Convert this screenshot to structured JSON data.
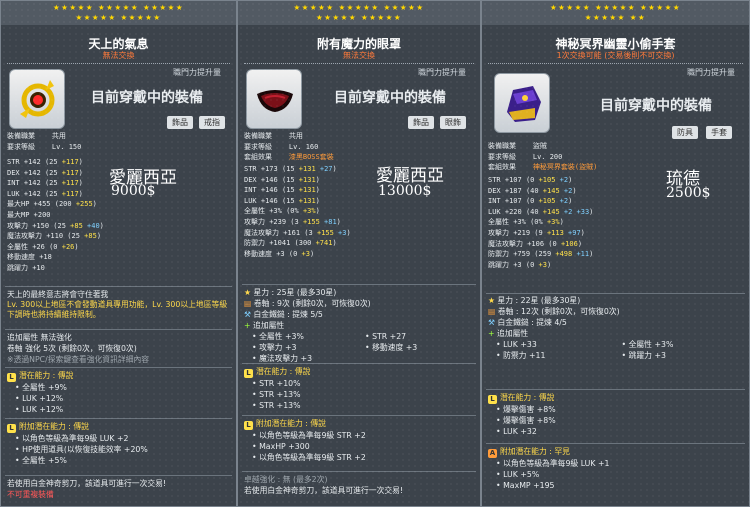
{
  "panels": [
    {
      "stars_row1": "★★★★★ ★★★★★ ★★★★★",
      "stars_row2": "★★★★★ ★★★★★",
      "title": "天上的氣息",
      "subtitle": "無法交換",
      "growth_label": "職門力提升量",
      "equipped_label": "目前穿戴中的裝備",
      "tags": [
        "飾品",
        "戒指"
      ],
      "job_label": "裝備職業",
      "job_value": "共用",
      "level_label": "要求等級",
      "level_value": "Lv. 150",
      "stats": [
        {
          "label": "STR",
          "base": "+142",
          "detail": "(25 ",
          "plus": "+117",
          "close": ")"
        },
        {
          "label": "DEX",
          "base": "+142",
          "detail": "(25 ",
          "plus": "+117",
          "close": ")"
        },
        {
          "label": "INT",
          "base": "+142",
          "detail": "(25 ",
          "plus": "+117",
          "close": ")"
        },
        {
          "label": "LUK",
          "base": "+142",
          "detail": "(25 ",
          "plus": "+117",
          "close": ")"
        },
        {
          "label": "最大HP",
          "base": "+455",
          "detail": "(200 ",
          "plus": "+255",
          "close": ")"
        },
        {
          "label": "最大MP",
          "base": "+200",
          "detail": "",
          "plus": "",
          "close": ""
        },
        {
          "label": "攻擊力",
          "base": "+150",
          "detail": "(25 ",
          "plus": "+85",
          "plus2": " +40",
          "close": ")"
        },
        {
          "label": "魔法攻擊力",
          "base": "+110",
          "detail": "(25 ",
          "plus": "+85",
          "close": ")"
        },
        {
          "label": "全屬性",
          "base": "+26",
          "detail": "(0 ",
          "plus": "+26",
          "close": ")"
        },
        {
          "label": "移動速度",
          "base": "+18",
          "detail": "",
          "plus": "",
          "close": ""
        },
        {
          "label": "跳躍力",
          "base": "+10",
          "detail": "",
          "plus": "",
          "close": ""
        }
      ],
      "handwritten_name": "愛麗西亞",
      "handwritten_price": "9000$",
      "desc_line1": "天上的最終意志將會守住著我",
      "desc_line2": "Lv. 300以上地區不會發動道具專用功能，Lv. 300以上地區等級下調時也將持續維持限制。",
      "extra_opt": "追加屬性 無法強化",
      "extra_opt2": "卷軸 強化 5次 (剩餘0次，可恢復0次)",
      "extra_note": "※透過NPC/探索鍵查看強化資訊詳細內容",
      "potential_header": "潛在能力 : 傳說",
      "potential_lines": [
        "全屬性 +9%",
        "LUK +12%",
        "LUK +12%"
      ],
      "addpot_header": "附加潛在能力 : 傳說",
      "addpot_lines": [
        "以角色等級為準每9級 LUK +2",
        "HP使用道具(以恢復技能效率 +20%",
        "全屬性 +5%"
      ],
      "footer1": "若使用白金神奇剪刀，該道具可進行一次交易!",
      "footer2": "不可重複裝備"
    },
    {
      "stars_row1": "★★★★★ ★★★★★ ★★★★★",
      "stars_row2": "★★★★★ ★★★★★",
      "title": "附有魔力的眼罩",
      "subtitle": "無法交換",
      "growth_label": "職門力提升量",
      "equipped_label": "目前穿戴中的裝備",
      "tags": [
        "飾品",
        "眼飾"
      ],
      "job_label": "裝備職業",
      "job_value": "共用",
      "level_label": "要求等級",
      "level_value": "Lv. 160",
      "set_label": "套組效果",
      "set_value": "漆黑BOSS套裝",
      "stats": [
        {
          "label": "STR",
          "base": "+173",
          "detail": "(15 ",
          "plus": "+131",
          "plus2": " +27",
          "close": ")"
        },
        {
          "label": "DEX",
          "base": "+146",
          "detail": "(15 ",
          "plus": "+131",
          "close": ")"
        },
        {
          "label": "INT",
          "base": "+146",
          "detail": "(15 ",
          "plus": "+131",
          "close": ")"
        },
        {
          "label": "LUK",
          "base": "+146",
          "detail": "(15 ",
          "plus": "+131",
          "close": ")"
        },
        {
          "label": "全屬性",
          "base": "+3%",
          "detail": "(0% ",
          "plus": "+3%",
          "close": ")"
        },
        {
          "label": "攻擊力",
          "base": "+239",
          "detail": "(3 ",
          "plus": "+155",
          "plus2": " +81",
          "close": ")"
        },
        {
          "label": "魔法攻擊力",
          "base": "+161",
          "detail": "(3 ",
          "plus": "+155",
          "plus2": " +3",
          "close": ")"
        },
        {
          "label": "防禦力",
          "base": "+1041",
          "detail": "(300 ",
          "plus": "+741",
          "close": ")"
        },
        {
          "label": "移動速度",
          "base": "+3",
          "detail": "(0 ",
          "plus": "+3",
          "close": ")"
        }
      ],
      "handwritten_name": "愛麗西亞",
      "handwritten_price": "13000$",
      "starforce": "星力 : 25星 (最多30星)",
      "scroll": "卷軸 : 9次 (剩餘0次，可恢復0次)",
      "hammer": "白金鐵鎚 : 提煉 5/5",
      "extra_header": "追加屬性",
      "extra_grid": [
        "全屬性 +3%",
        "STR +27",
        "攻擊力 +3",
        "移動速度 +3",
        "魔法攻擊力 +3",
        ""
      ],
      "potential_header": "潛在能力 : 傳說",
      "potential_lines": [
        "STR +10%",
        "STR +13%",
        "STR +13%"
      ],
      "addpot_header": "附加潛在能力 : 傳說",
      "addpot_lines": [
        "以角色等級為準每9級 STR +2",
        "MaxHP +300",
        "以角色等級為準每9級 STR +2"
      ],
      "soul_line": "卓越強化 : 無 (最多2次)",
      "footer1": "若使用白金神奇剪刀，該道具可進行一次交易!"
    },
    {
      "stars_row1": "★★★★★ ★★★★★ ★★★★★",
      "stars_row2": "★★★★★ ★★",
      "title": "神秘冥界幽靈小偷手套",
      "subtitle": "1次交換可能 (交易後則不可交換)",
      "growth_label": "職門力提升量",
      "equipped_label": "目前穿戴中的裝備",
      "tags": [
        "防具",
        "手套"
      ],
      "job_label": "裝備職業",
      "job_value": "盜賊",
      "level_label": "要求等級",
      "level_value": "Lv. 200",
      "set_label": "套組效果",
      "set_value": "神秘冥界套裝(盜賊)",
      "stats": [
        {
          "label": "STR",
          "base": "+107",
          "detail": "(0 ",
          "plus": "+105",
          "plus2": " +2",
          "close": ")"
        },
        {
          "label": "DEX",
          "base": "+187",
          "detail": "(40 ",
          "plus": "+145",
          "plus2": " +2",
          "close": ")"
        },
        {
          "label": "INT",
          "base": "+107",
          "detail": "(0 ",
          "plus": "+105",
          "plus2": " +2",
          "close": ")"
        },
        {
          "label": "LUK",
          "base": "+220",
          "detail": "(40 ",
          "plus": "+145",
          "plus2": " +2 +33",
          "close": ")"
        },
        {
          "label": "全屬性",
          "base": "+3%",
          "detail": "(0% ",
          "plus": "+3%",
          "close": ")"
        },
        {
          "label": "攻擊力",
          "base": "+219",
          "detail": "(9 ",
          "plus": "+113",
          "plus2": " +97",
          "close": ")"
        },
        {
          "label": "魔法攻擊力",
          "base": "+106",
          "detail": "(0 ",
          "plus": "+106",
          "close": ")"
        },
        {
          "label": "防禦力",
          "base": "+759",
          "detail": "(259 ",
          "plus": "+498",
          "plus2": " +11",
          "close": ")"
        },
        {
          "label": "跳躍力",
          "base": "+3",
          "detail": "(0 ",
          "plus": "+3",
          "close": ")"
        }
      ],
      "handwritten_name": "琉德",
      "handwritten_price": "2500$",
      "starforce": "星力 : 22星 (最多30星)",
      "scroll": "卷軸 : 12次 (剩餘0次，可恢復0次)",
      "hammer": "白金鐵鎚 : 提煉 4/5",
      "extra_header": "追加屬性",
      "extra_grid": [
        "LUK +33",
        "全屬性 +3%",
        "防禦力 +11",
        "跳躍力 +3"
      ],
      "potential_header": "潛在能力 : 傳說",
      "potential_lines": [
        "爆擊傷害 +8%",
        "爆擊傷害 +8%",
        "LUK +32"
      ],
      "addpot_header": "附加潛在能力 : 罕見",
      "addpot_lines": [
        "以角色等級為準每9級 LUK +1",
        "LUK +5%",
        "MaxMP +195"
      ]
    }
  ],
  "colors": {
    "star": "#ffd700",
    "title_red": "#ff7a3a",
    "green": "#9eff3a",
    "yellow": "#ffe14a",
    "blue": "#7fd0ff"
  }
}
